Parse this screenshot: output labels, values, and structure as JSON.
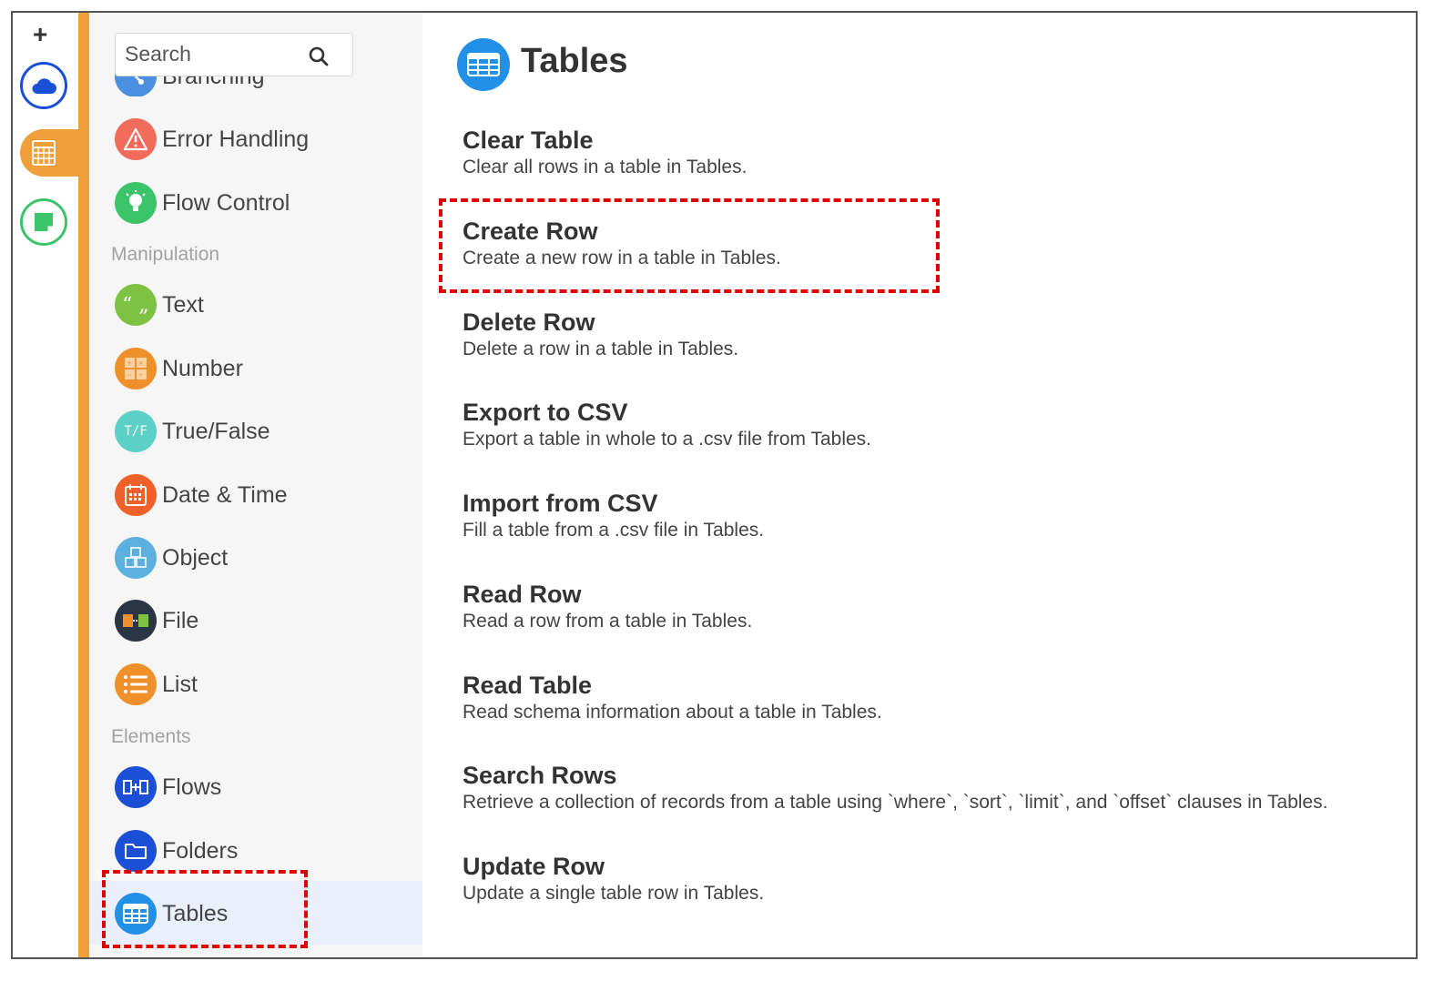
{
  "rail": {
    "add_symbol": "+",
    "buttons": [
      "cloud",
      "tables",
      "notes"
    ]
  },
  "sidebar": {
    "search_placeholder": "Search",
    "partial_item": "Branching",
    "items_control": [
      {
        "label": "Error Handling",
        "icon": "warning-icon",
        "color": "#f26b5b"
      },
      {
        "label": "Flow Control",
        "icon": "lightbulb-icon",
        "color": "#3cc46a"
      }
    ],
    "section_manipulation": "Manipulation",
    "items_manipulation": [
      {
        "label": "Text",
        "icon": "quote-icon",
        "color": "#7dc242"
      },
      {
        "label": "Number",
        "icon": "calculator-icon",
        "color": "#f0902a"
      },
      {
        "label": "True/False",
        "icon": "true-false-icon",
        "color": "#5ccfc7"
      },
      {
        "label": "Date & Time",
        "icon": "calendar-icon",
        "color": "#f0602a"
      },
      {
        "label": "Object",
        "icon": "cubes-icon",
        "color": "#5bb0e0"
      },
      {
        "label": "File",
        "icon": "file-icon",
        "color": "#2a3545"
      },
      {
        "label": "List",
        "icon": "list-icon",
        "color": "#f0902a"
      }
    ],
    "section_elements": "Elements",
    "items_elements": [
      {
        "label": "Flows",
        "icon": "flows-icon",
        "color": "#1a4fd6"
      },
      {
        "label": "Folders",
        "icon": "folder-icon",
        "color": "#1a4fd6"
      },
      {
        "label": "Tables",
        "icon": "table-icon",
        "color": "#2190e6"
      }
    ],
    "selected": "Tables"
  },
  "main": {
    "title": "Tables",
    "actions": [
      {
        "title": "Clear Table",
        "desc": "Clear all rows in a table in Tables."
      },
      {
        "title": "Create Row",
        "desc": "Create a new row in a table in Tables."
      },
      {
        "title": "Delete Row",
        "desc": "Delete a row in a table in Tables."
      },
      {
        "title": "Export to CSV",
        "desc": "Export a table in whole to a .csv file from Tables."
      },
      {
        "title": "Import from CSV",
        "desc": "Fill a table from a .csv file in Tables."
      },
      {
        "title": "Read Row",
        "desc": "Read a row from a table in Tables."
      },
      {
        "title": "Read Table",
        "desc": "Read schema information about a table in Tables."
      },
      {
        "title": "Search Rows",
        "desc": "Retrieve a collection of records from a table using `where`, `sort`, `limit`, and `offset` clauses in Tables."
      },
      {
        "title": "Update Row",
        "desc": "Update a single table row in Tables."
      }
    ],
    "highlighted_action": "Create Row"
  },
  "colors": {
    "accent_orange": "#f0a03a",
    "highlight_red": "#e00000",
    "tables_blue": "#2190e6"
  }
}
